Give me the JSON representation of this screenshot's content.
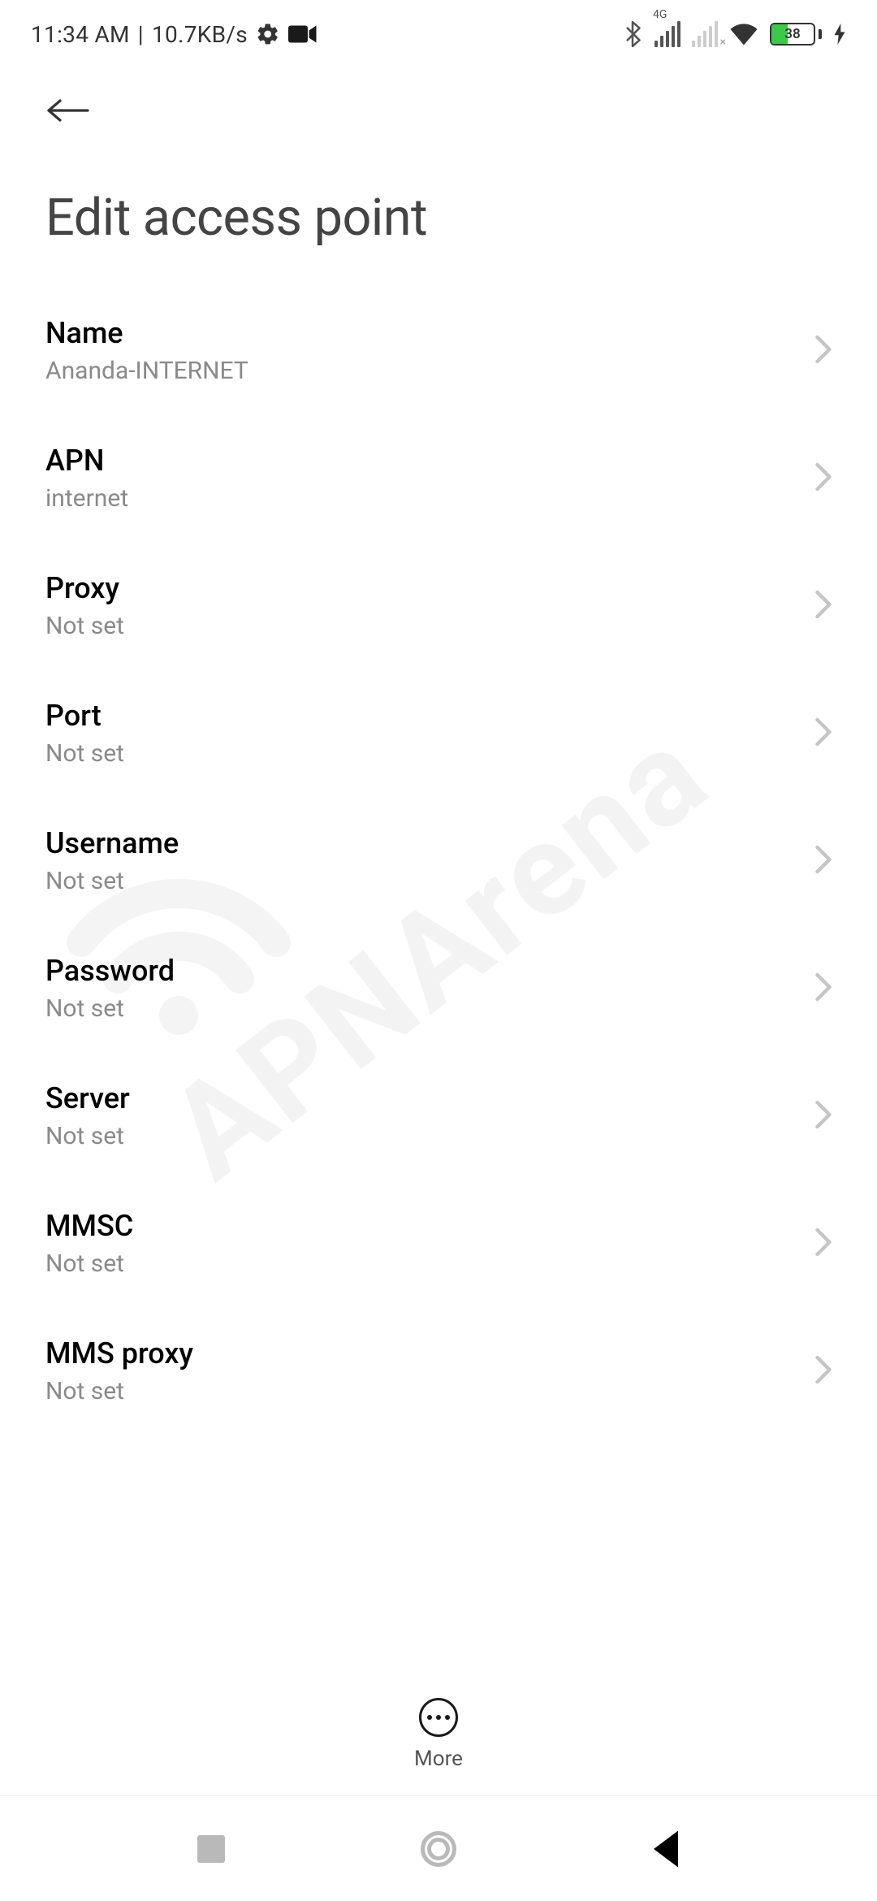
{
  "status": {
    "time": "11:34 AM",
    "separator": "|",
    "net_speed": "10.7KB/s",
    "network_tag": "4G",
    "battery_pct": 38,
    "battery_text": "38"
  },
  "header": {
    "title": "Edit access point"
  },
  "settings": [
    {
      "label": "Name",
      "value": "Ananda-INTERNET"
    },
    {
      "label": "APN",
      "value": "internet"
    },
    {
      "label": "Proxy",
      "value": "Not set"
    },
    {
      "label": "Port",
      "value": "Not set"
    },
    {
      "label": "Username",
      "value": "Not set"
    },
    {
      "label": "Password",
      "value": "Not set"
    },
    {
      "label": "Server",
      "value": "Not set"
    },
    {
      "label": "MMSC",
      "value": "Not set"
    },
    {
      "label": "MMS proxy",
      "value": "Not set"
    }
  ],
  "bottom_action": {
    "label": "More"
  },
  "watermark": "APNArena"
}
